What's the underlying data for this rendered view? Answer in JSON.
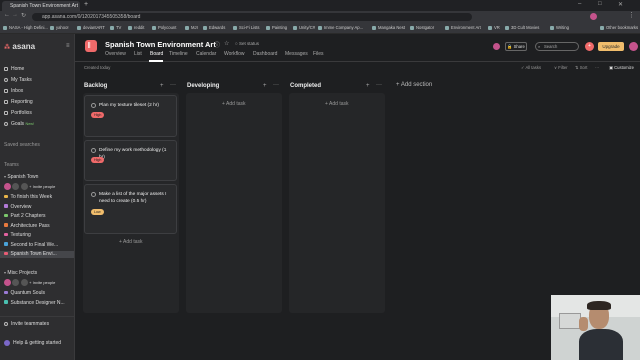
{
  "browser": {
    "active_tab": "Spanish Town Environment Art",
    "url": "app.asana.com/0/1202017345505358/board",
    "bookmarks": [
      "NASA - High Defini...",
      "yahoo!",
      "deviantART",
      "TV",
      "reddit",
      "Polycount",
      "MJI",
      "Edwards",
      "Sci-Fi Lists",
      "Painting",
      "Unity/C#",
      "Imme Company Ap...",
      "Mangaka Nest",
      "Nostgator",
      "Environment Art",
      "VR",
      "3D Cult Movies",
      "Writing",
      "Other bookmarks"
    ]
  },
  "sidebar": {
    "brand": "asana",
    "nav": [
      "Home",
      "My Tasks",
      "Inbox",
      "Reporting",
      "Portfolios",
      "Goals"
    ],
    "goals_badge": "New!",
    "saved_searches": "Saved searches",
    "teams_label": "Teams",
    "team_name": "Spanish Town",
    "invite_label": "Invite people",
    "projects": [
      {
        "name": "To finish this Week",
        "color": "#e8b54a"
      },
      {
        "name": "Overview",
        "color": "#b27ad6"
      },
      {
        "name": "Part 2 Chapters",
        "color": "#7bc86c"
      },
      {
        "name": "Architecture Pass",
        "color": "#e87a3e"
      },
      {
        "name": "Texturing",
        "color": "#e362a0"
      },
      {
        "name": "Second to Final We...",
        "color": "#4aa3d9"
      },
      {
        "name": "Spanish Town Envi...",
        "color": "#e85d75"
      }
    ],
    "misc_team": "Misc Projects",
    "misc_projects": [
      {
        "name": "Quantum Souls",
        "color": "#9b7ad6"
      },
      {
        "name": "Substance Designer N...",
        "color": "#4ac0b0"
      }
    ],
    "invite_teammates": "Invite teammates",
    "help": "Help & getting started"
  },
  "header": {
    "project_title": "Spanish Town Environment Art",
    "set_status": "Set status",
    "tabs": [
      "Overview",
      "List",
      "Board",
      "Timeline",
      "Calendar",
      "Workflow",
      "Dashboard",
      "Messages",
      "Files"
    ],
    "active_tab": "Board",
    "share": "Share",
    "search_placeholder": "Search",
    "upgrade": "Upgrade",
    "created_today": "Created today"
  },
  "toolbar": {
    "all_tasks": "All tasks",
    "filter": "Filter",
    "sort": "Sort",
    "customize": "Customize"
  },
  "board": {
    "columns": [
      {
        "title": "Backlog"
      },
      {
        "title": "Developing"
      },
      {
        "title": "Completed"
      }
    ],
    "add_section": "Add section",
    "add_task": "Add task",
    "cards": [
      {
        "title": "Plan my texture tileset (2 hr)",
        "badge": "High",
        "badge_color": "#f06a6a"
      },
      {
        "title": "Define my work methodology (1 hr)",
        "badge": "High",
        "badge_color": "#f06a6a"
      },
      {
        "title": "Make a list of the major assets I need to create (0.5 hr)",
        "badge": "Low",
        "badge_color": "#f1bd6c"
      }
    ]
  },
  "colors": {
    "brand": "#f06a6a",
    "upgrade": "#f1bd6c",
    "project_icon": "#f06a6a"
  }
}
